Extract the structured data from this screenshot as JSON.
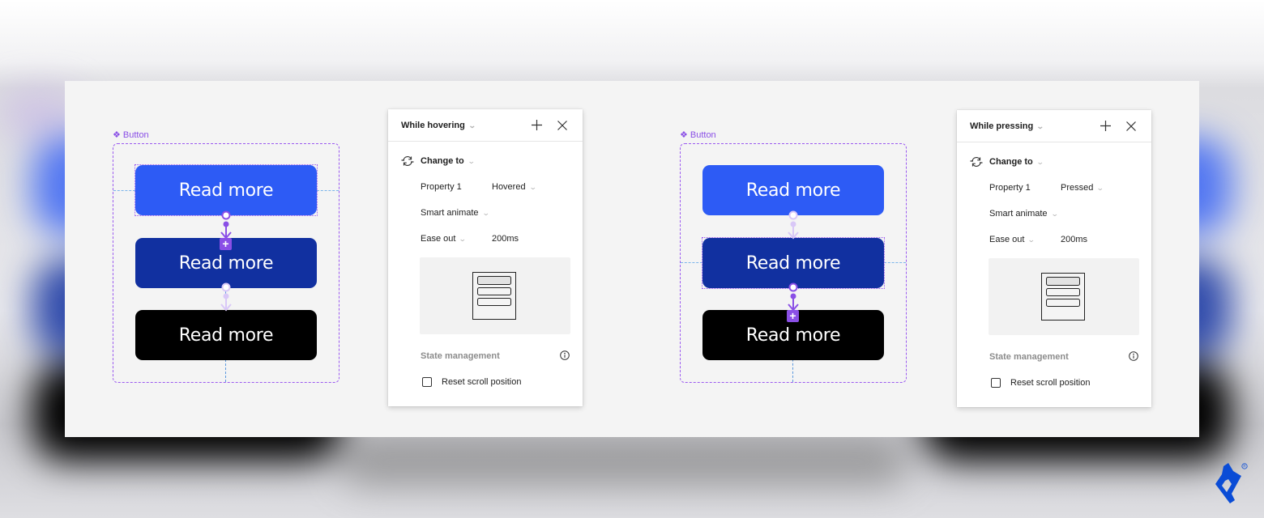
{
  "brand": {
    "accent": "#8a4fe6",
    "logo_color": "#0a4cd6",
    "logo_name": "toptal-logo"
  },
  "frames": [
    {
      "component_label": "Button",
      "buttons": [
        {
          "label": "Read more",
          "state": "default",
          "color": "#2d5bf5"
        },
        {
          "label": "Read more",
          "state": "hovered",
          "color": "#1130a0"
        },
        {
          "label": "Read more",
          "state": "pressed",
          "color": "#000000"
        }
      ],
      "selected_variant": "default",
      "panel": {
        "trigger": "While hovering",
        "action": "Change to",
        "property_label": "Property 1",
        "property_value": "Hovered",
        "animation": "Smart animate",
        "easing": "Ease out",
        "duration": "200ms",
        "state_management_label": "State management",
        "reset_scroll_label": "Reset scroll position",
        "reset_scroll_checked": false
      }
    },
    {
      "component_label": "Button",
      "buttons": [
        {
          "label": "Read more",
          "state": "default",
          "color": "#2d5bf5"
        },
        {
          "label": "Read more",
          "state": "hovered",
          "color": "#1130a0"
        },
        {
          "label": "Read more",
          "state": "pressed",
          "color": "#000000"
        }
      ],
      "selected_variant": "hovered",
      "panel": {
        "trigger": "While pressing",
        "action": "Change to",
        "property_label": "Property 1",
        "property_value": "Pressed",
        "animation": "Smart animate",
        "easing": "Ease out",
        "duration": "200ms",
        "state_management_label": "State management",
        "reset_scroll_label": "Reset scroll position",
        "reset_scroll_checked": false
      }
    }
  ]
}
